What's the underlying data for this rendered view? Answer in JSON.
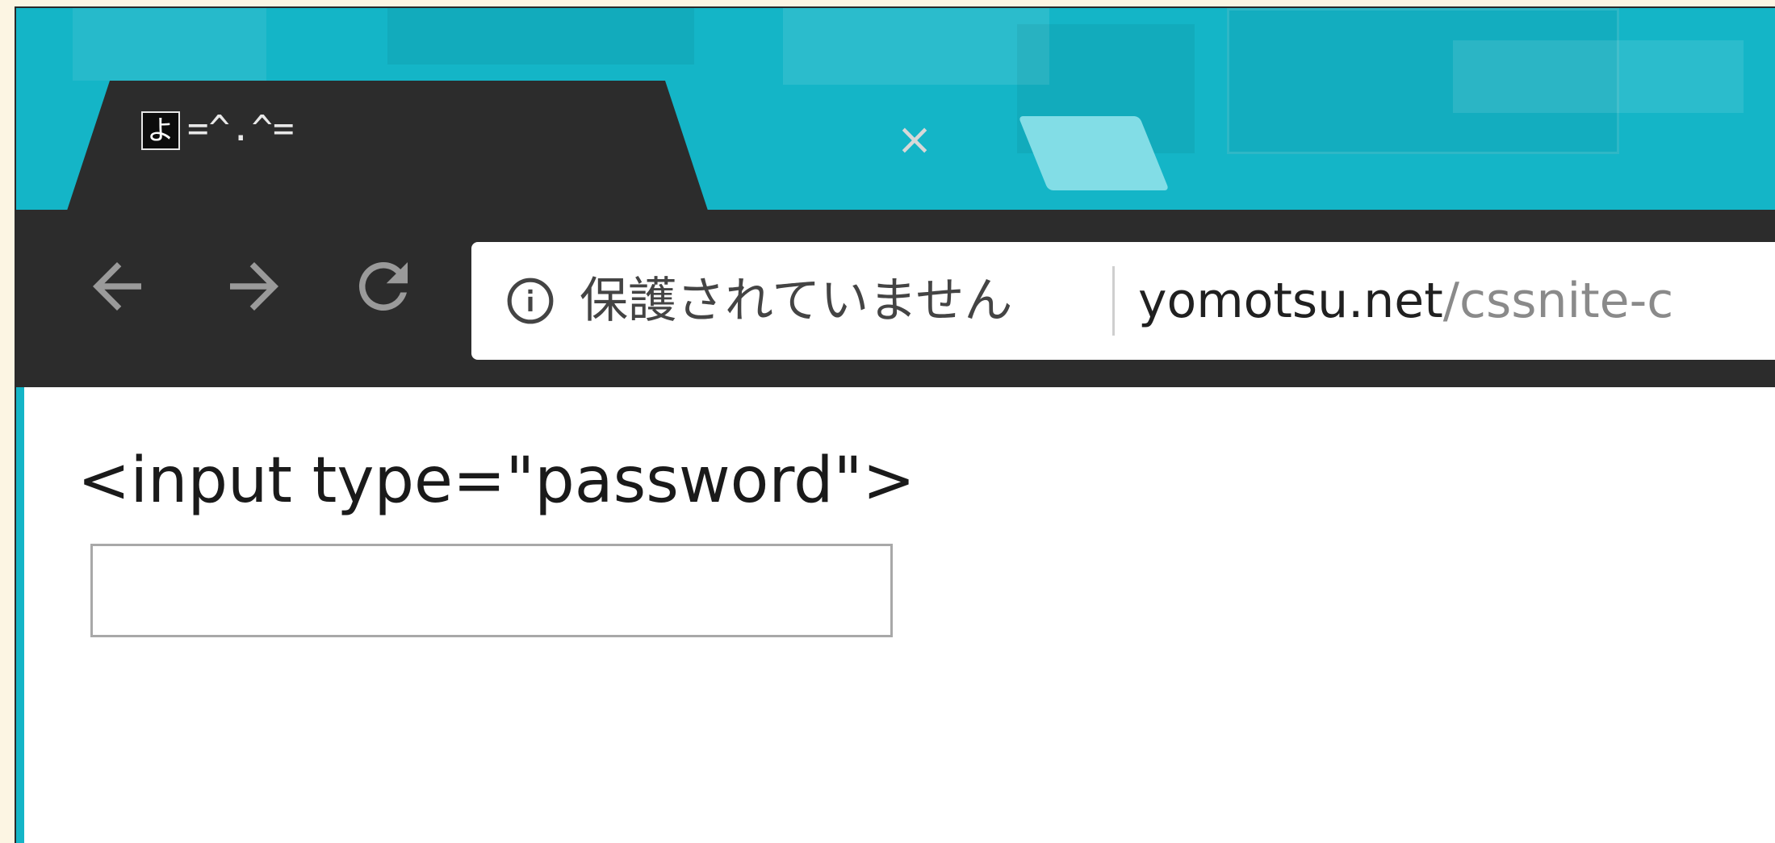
{
  "browser": {
    "tab": {
      "title": "=^.^=",
      "favicon_glyph": "よ",
      "close_glyph": "×"
    },
    "toolbar": {
      "back_icon": "arrow-left-icon",
      "forward_icon": "arrow-right-icon",
      "reload_icon": "reload-icon"
    },
    "omnibox": {
      "security_icon": "info-icon",
      "security_label": "保護されていません",
      "url_host": "yomotsu.net",
      "url_path": "/cssnite-c"
    },
    "theme": {
      "frame_color": "#14b5c7",
      "toolbar_color": "#2c2c2c"
    }
  },
  "page": {
    "code_label": "<input type=\"password\">",
    "password_field": {
      "value": "",
      "placeholder": ""
    }
  }
}
